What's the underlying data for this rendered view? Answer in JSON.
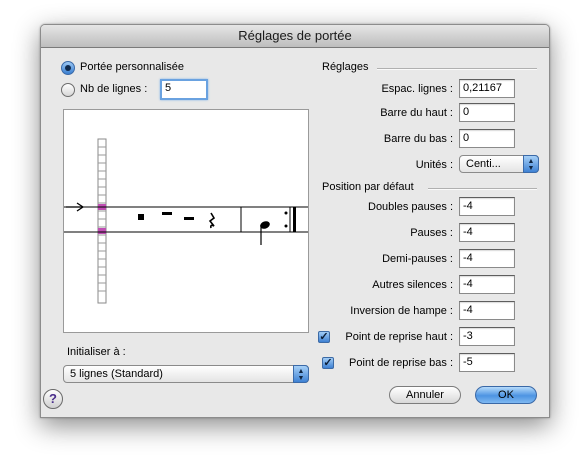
{
  "window": {
    "title": "Réglages de portée"
  },
  "staff_type": {
    "custom_label": "Portée personnalisée",
    "custom_selected": true,
    "lines_label": "Nb de lignes :",
    "lines_selected": false,
    "lines_value": "5"
  },
  "settings": {
    "section_label": "Réglages",
    "spacing_label": "Espac. lignes :",
    "spacing_value": "0,21167",
    "top_label": "Barre du haut :",
    "top_value": "0",
    "bottom_label": "Barre du bas :",
    "bottom_value": "0",
    "units_label": "Unités :",
    "units_value": "Centi..."
  },
  "defaults": {
    "section_label": "Position par défaut",
    "double_rests_label": "Doubles pauses :",
    "double_rests_value": "-4",
    "rests_label": "Pauses :",
    "rests_value": "-4",
    "half_rests_label": "Demi-pauses :",
    "half_rests_value": "-4",
    "other_rests_label": "Autres silences :",
    "other_rests_value": "-4",
    "stem_flip_label": "Inversion de hampe :",
    "stem_flip_value": "-4",
    "repeat_top_label": "Point de reprise haut :",
    "repeat_top_value": "-3",
    "repeat_top_checked": true,
    "repeat_bottom_label": "Point de reprise bas :",
    "repeat_bottom_value": "-5",
    "repeat_bottom_checked": true
  },
  "init": {
    "label": "Initialiser à :",
    "value": "5 lignes (Standard)"
  },
  "buttons": {
    "cancel": "Annuler",
    "ok": "OK",
    "help": "?"
  },
  "colors": {
    "accent": "#4d94e2",
    "marker": "#c04fb4"
  }
}
